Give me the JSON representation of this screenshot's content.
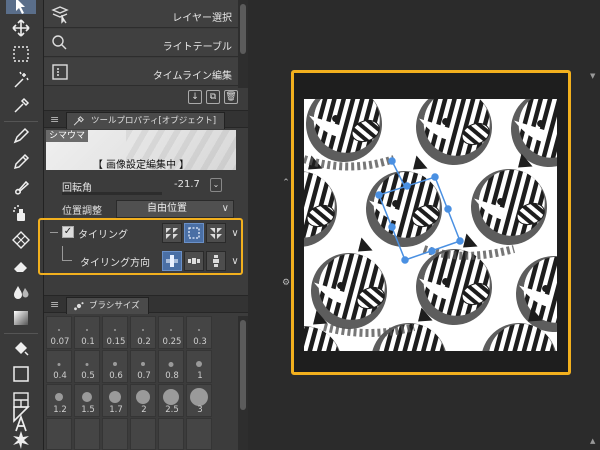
{
  "panel": {
    "menu_items": [
      {
        "label": "レイヤー選択",
        "icon": "layer-select-icon"
      },
      {
        "label": "ライトテーブル",
        "icon": "light-table-icon"
      },
      {
        "label": "タイムライン編集",
        "icon": "timeline-icon"
      }
    ],
    "tool_property": {
      "tab_label": "ツールプロパティ[オブジェクト]",
      "preview_name": "シマウマ",
      "preview_status": "【 画像設定編集中 】",
      "rotation_label": "回転角",
      "rotation_value": "-21.7",
      "position_label": "位置調整",
      "position_value": "自由位置",
      "tiling_label": "タイリング",
      "tiling_checked": "✓",
      "tiling_direction_label": "タイリング方向"
    },
    "brush_size": {
      "tab_label": "ブラシサイズ",
      "sizes": [
        "0.07",
        "0.1",
        "0.15",
        "0.2",
        "0.25",
        "0.3",
        "0.4",
        "0.5",
        "0.6",
        "0.7",
        "0.8",
        "1",
        "1.2",
        "1.5",
        "1.7",
        "2",
        "2.5",
        "3"
      ]
    }
  },
  "colors": {
    "highlight": "#f2b01e",
    "selection": "#4a90e2",
    "active_toggle": "#4a6fa5"
  }
}
